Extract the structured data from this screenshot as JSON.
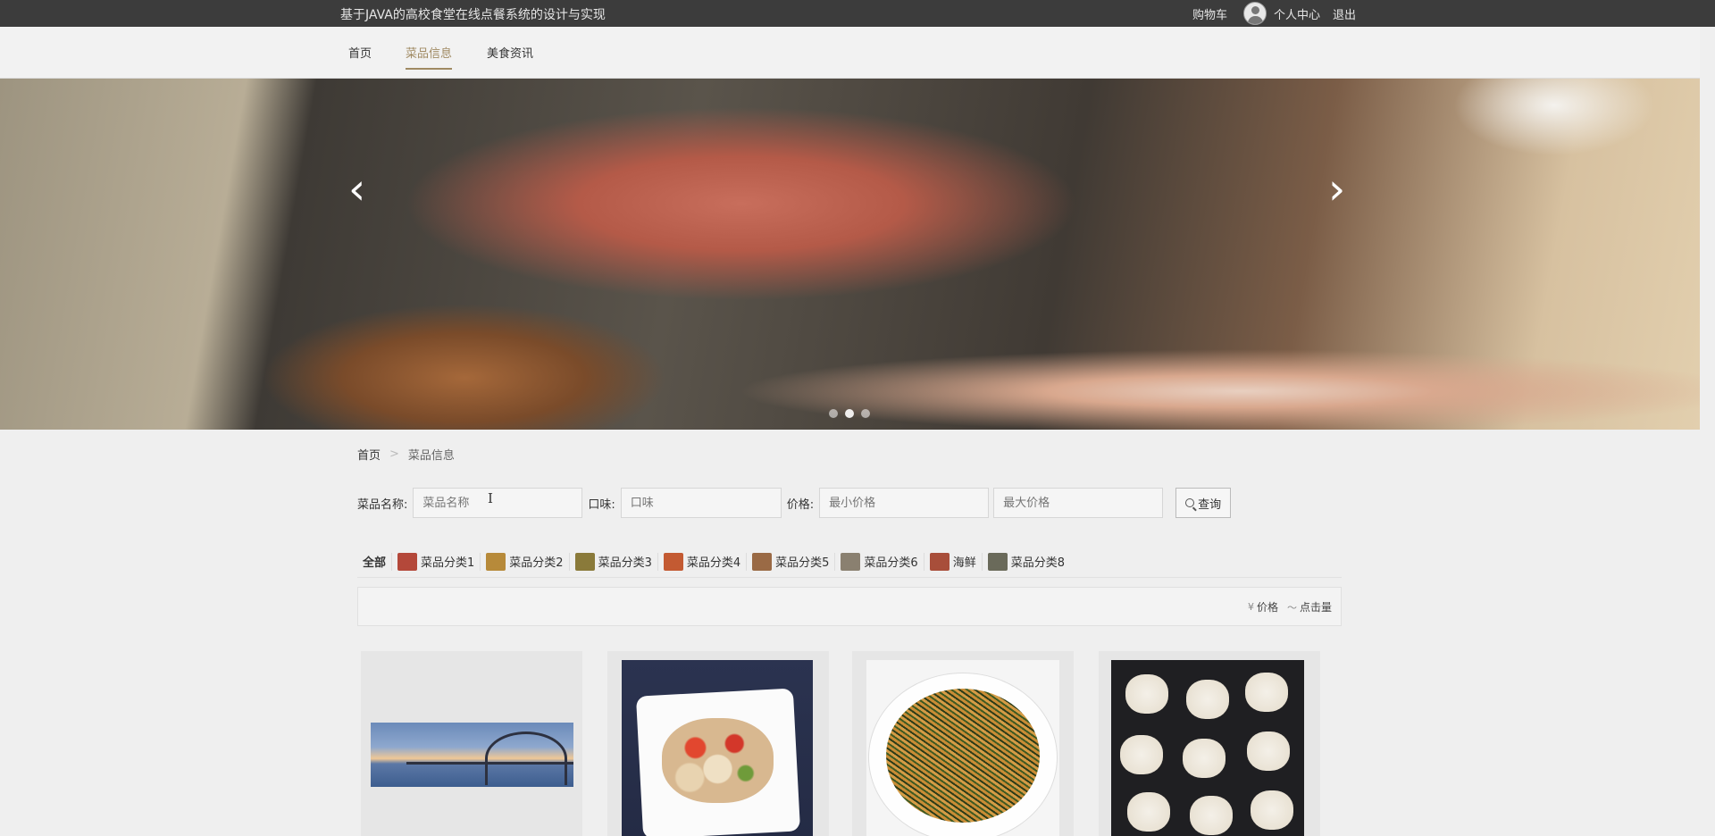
{
  "header": {
    "site_title": "基于JAVA的高校食堂在线点餐系统的设计与实现",
    "cart": "购物车",
    "profile": "个人中心",
    "logout": "退出"
  },
  "nav": {
    "items": [
      {
        "label": "首页"
      },
      {
        "label": "菜品信息"
      },
      {
        "label": "美食资讯"
      }
    ],
    "active_index": 1
  },
  "banner": {
    "prev_glyph": "‹",
    "next_glyph": "›",
    "slide_count": 3,
    "active_slide": 1
  },
  "breadcrumb": {
    "home": "首页",
    "separator": ">",
    "current": "菜品信息"
  },
  "search": {
    "name_label": "菜品名称:",
    "name_placeholder": "菜品名称",
    "taste_label": "口味:",
    "taste_placeholder": "口味",
    "price_label": "价格:",
    "min_price_placeholder": "最小价格",
    "max_price_placeholder": "最大价格",
    "query_button": "查询"
  },
  "categories": {
    "all": "全部",
    "items": [
      {
        "label": "菜品分类1",
        "color": "#b4483a"
      },
      {
        "label": "菜品分类2",
        "color": "#b78a3a"
      },
      {
        "label": "菜品分类3",
        "color": "#8a7a3a"
      },
      {
        "label": "菜品分类4",
        "color": "#c35a32"
      },
      {
        "label": "菜品分类5",
        "color": "#9a6a45"
      },
      {
        "label": "菜品分类6",
        "color": "#8a8070"
      },
      {
        "label": "海鲜",
        "color": "#a84e3a"
      },
      {
        "label": "菜品分类8",
        "color": "#6a6a5a"
      }
    ]
  },
  "sort": {
    "price_icon": "¥",
    "price": "价格",
    "clicks_icon": "〜",
    "clicks": "点击量"
  },
  "products": [
    {
      "name": "bridge-landscape-image"
    },
    {
      "name": "lotus-root-dish-image"
    },
    {
      "name": "stir-fried-noodles-image"
    },
    {
      "name": "lotus-pastry-image"
    }
  ],
  "colors": {
    "topbar": "#3c3c3c",
    "accent": "#a08a63",
    "page_bg": "#efefef"
  }
}
